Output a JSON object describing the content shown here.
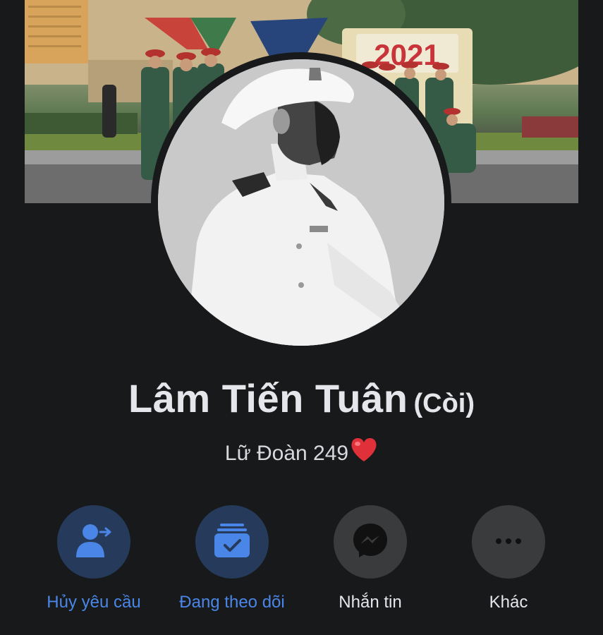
{
  "profile": {
    "name": "Lâm Tiến Tuân",
    "alternate_name": "(Còi)",
    "bio_text": "Lữ Đoàn 249",
    "bio_emoji": "red-heart-icon"
  },
  "cover_photo": {
    "sign_text": "2021"
  },
  "actions": [
    {
      "label": "Hủy yêu cầu",
      "icon": "cancel-friend-request-icon"
    },
    {
      "label": "Đang theo dõi",
      "icon": "following-icon"
    },
    {
      "label": "Nhắn tin",
      "icon": "messenger-icon"
    },
    {
      "label": "Khác",
      "icon": "more-icon"
    }
  ],
  "colors": {
    "background": "#18191a",
    "accent_blue": "#4a86e8",
    "button_blue_bg": "#263a5c",
    "button_gray_bg": "#3a3b3c",
    "text_primary": "#e4e6eb"
  }
}
